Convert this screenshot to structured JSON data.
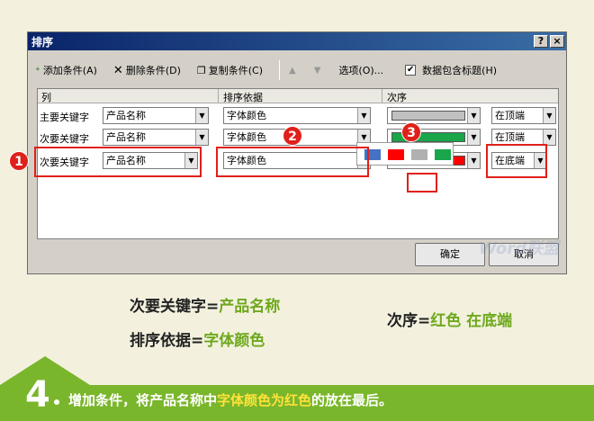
{
  "dialog": {
    "title": "排序",
    "help_label": "?",
    "close_label": "×",
    "toolbar": {
      "add_condition": "添加条件(A)",
      "delete_condition": "删除条件(D)",
      "copy_condition": "复制条件(C)",
      "move_up": "▲",
      "move_down": "▼",
      "options": "选项(O)...",
      "has_header_check": "✔",
      "has_header": "数据包含标题(H)"
    },
    "columns": {
      "col": "列",
      "sort_on": "排序依据",
      "order": "次序"
    },
    "rows": [
      {
        "label": "主要关键字",
        "column": "产品名称",
        "sort_on": "字体颜色",
        "color": "#c0c0c0",
        "position": "在顶端"
      },
      {
        "label": "次要关键字",
        "column": "产品名称",
        "sort_on": "字体颜色",
        "color": "#1aa64a",
        "position": "在顶端"
      },
      {
        "label": "次要关键字",
        "column": "产品名称",
        "sort_on": "字体颜色",
        "color": "#ff0000",
        "position": "在底端"
      }
    ],
    "palette": [
      "#4472c4",
      "#ff0000",
      "#b0b0b0",
      "#1aa64a"
    ],
    "ok_label": "确定",
    "cancel_label": "取消"
  },
  "badges": [
    "1",
    "2",
    "3"
  ],
  "notes": {
    "line1_key": "次要关键字=",
    "line1_val": "产品名称",
    "line2_key": "排序依据=",
    "line2_val": "字体颜色",
    "line3_key": "次序=",
    "line3_val1": "红色",
    "line3_val2": "在底端"
  },
  "footer": {
    "step": "4",
    "text_a": "增加条件，将产品名称中",
    "text_hl": "字体颜色为红色",
    "text_b": "的放在最后。"
  },
  "watermark": "Word联盟"
}
